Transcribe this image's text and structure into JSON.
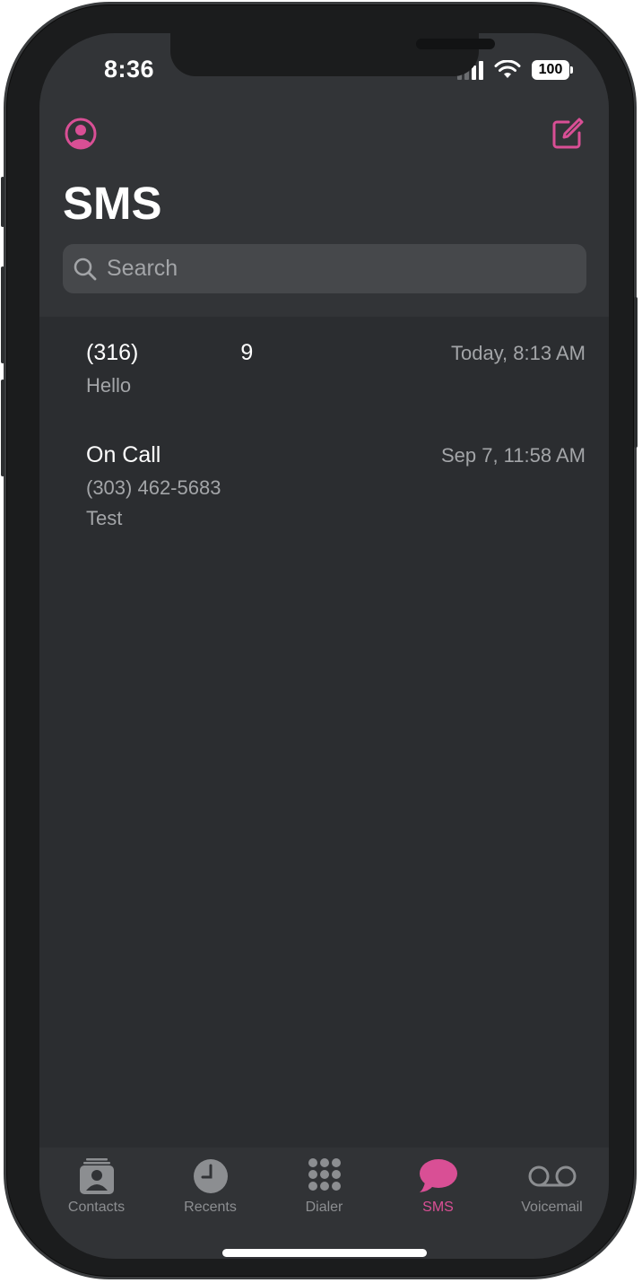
{
  "status_bar": {
    "time": "8:36",
    "battery": "100"
  },
  "header": {
    "title": "SMS"
  },
  "search": {
    "placeholder": "Search"
  },
  "conversations": [
    {
      "contact_prefix": "(316)",
      "contact_suffix": "9",
      "timestamp": "Today, 8:13 AM",
      "preview": "Hello"
    },
    {
      "contact": "On Call",
      "number": "(303) 462-5683",
      "timestamp": "Sep 7, 11:58 AM",
      "preview": "Test"
    }
  ],
  "tabs": [
    {
      "label": "Contacts",
      "icon": "contacts-icon"
    },
    {
      "label": "Recents",
      "icon": "clock-icon"
    },
    {
      "label": "Dialer",
      "icon": "keypad-icon"
    },
    {
      "label": "SMS",
      "icon": "chat-bubble-icon",
      "active": true
    },
    {
      "label": "Voicemail",
      "icon": "voicemail-icon"
    }
  ],
  "colors": {
    "accent": "#d94f95",
    "background": "#2b2d30",
    "header": "#323437",
    "muted_text": "#a3a5a8"
  }
}
